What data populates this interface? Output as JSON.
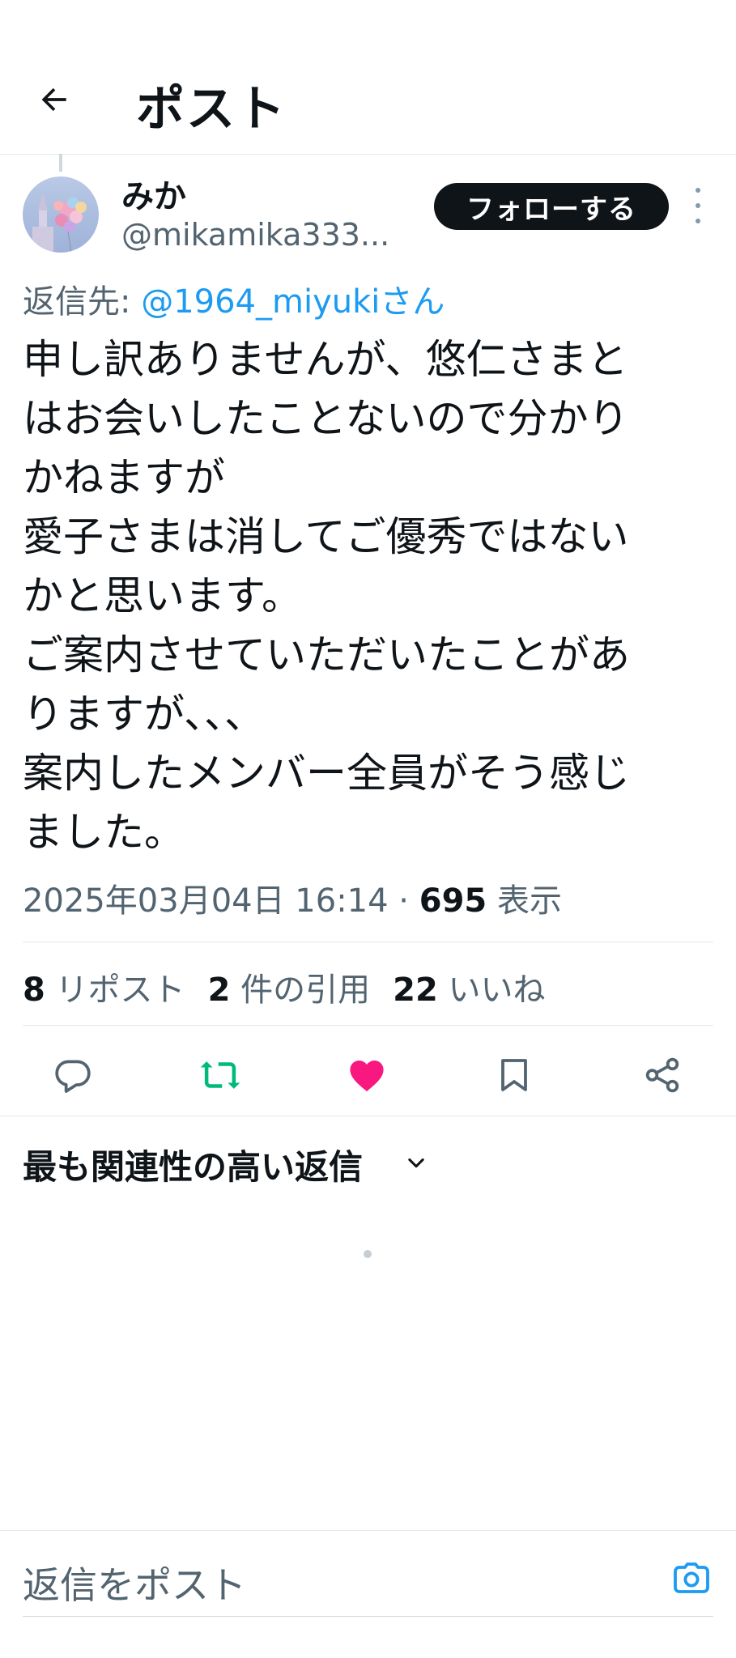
{
  "header": {
    "title": "ポスト",
    "back_icon": "arrow-left-icon"
  },
  "author": {
    "name": "みか",
    "handle": "@mikamika333...",
    "follow_label": "フォローする",
    "avatar_icon": "avatar-balloons"
  },
  "reply_to": {
    "prefix": "返信先: ",
    "mention": "@1964_miyukiさん"
  },
  "post": {
    "lines": [
      "申し訳ありませんが、悠仁さまと",
      "はお会いしたことないので分かり",
      "かねますが",
      "愛子さまは消してご優秀ではない",
      "かと思います。",
      "ご案内させていただいたことがあ",
      "りますが、、、",
      "案内したメンバー全員がそう感じ",
      "ました。"
    ],
    "timestamp": "2025年03月04日 16:14 · ",
    "views_count": "695",
    "views_label": " 表示"
  },
  "stats": {
    "reposts_count": "8",
    "reposts_label": " リポスト",
    "quotes_count": "2",
    "quotes_label": " 件の引用",
    "likes_count": "22",
    "likes_label": " いいね"
  },
  "actions": [
    {
      "name": "reply",
      "icon": "reply-icon"
    },
    {
      "name": "repost",
      "icon": "repost-icon",
      "color": "#00ba7c"
    },
    {
      "name": "like",
      "icon": "heart-icon",
      "color": "#f91880"
    },
    {
      "name": "bookmark",
      "icon": "bookmark-icon"
    },
    {
      "name": "share",
      "icon": "share-icon"
    }
  ],
  "replies": {
    "sort_label": "最も関連性の高い返信"
  },
  "composer": {
    "placeholder": "返信をポスト",
    "camera_icon": "camera-icon",
    "accent": "#1d9bf0"
  }
}
